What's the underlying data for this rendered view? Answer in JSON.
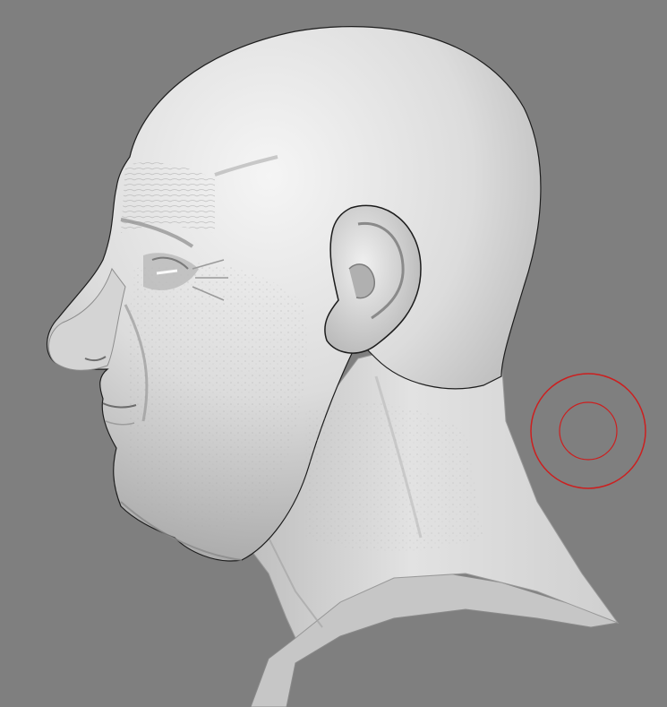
{
  "viewport": {
    "background_color": "#7f7f7f",
    "subject": "sculpted-head-mesh"
  },
  "mesh": {
    "material_color": "#d9d9d9",
    "highlight_color": "#f2f2f2",
    "shadow_color": "#9a9a9a",
    "outline_color": "#2a2a2a"
  },
  "brush": {
    "outer_ring_color": "#cc1f1f",
    "inner_ring_color": "#cc1f1f",
    "icon": "brush-cursor-icon"
  }
}
